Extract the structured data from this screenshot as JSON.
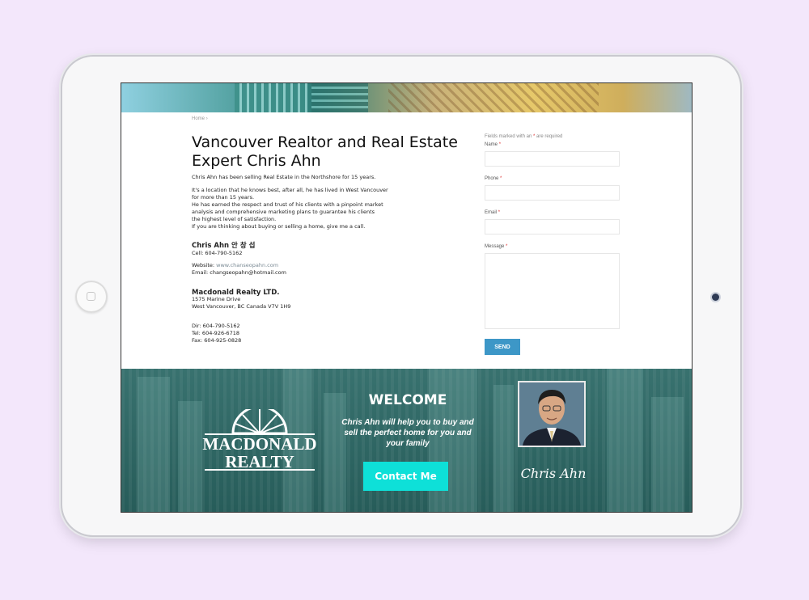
{
  "breadcrumb": {
    "home": "Home",
    "sep": "›"
  },
  "page": {
    "title": "Vancouver Realtor and Real Estate Expert Chris Ahn",
    "intro": "Chris Ahn has been selling Real Estate in the Northshore for 15 years.",
    "body_lines": [
      "It's a location that he knows best, after all, he has lived in West Vancouver",
      "for more than 15 years.",
      "He has earned the respect and trust of his clients with a pinpoint market",
      "analysis and comprehensive marketing plans to guarantee his clients",
      "the highest level of satisfaction.",
      "If you are thinking about buying or selling a home, give me a call."
    ]
  },
  "agent": {
    "name": "Chris Ahn 안 창 섭",
    "cell": "Cell: 604-790-5162",
    "website_label": "Website: ",
    "website": "www.chanseopahn.com",
    "email": "Email: changseopahn@hotmail.com"
  },
  "office": {
    "name": "Macdonald Realty LTD.",
    "address1": "1575 Marine Drive",
    "address2": "West Vancouver, BC Canada V7V 1H9",
    "dir": "Dir: 604-790-5162",
    "tel": "Tel: 604-926-6718",
    "fax": "Fax: 604-925-0828"
  },
  "form": {
    "note_prefix": "Fields marked with an ",
    "note_star": "*",
    "note_suffix": " are required",
    "name_label": "Name",
    "phone_label": "Phone",
    "email_label": "Email",
    "message_label": "Message",
    "star": "*",
    "send": "SEND"
  },
  "footer": {
    "logo_line1": "MACDONALD",
    "logo_line2": "REALTY",
    "welcome": "WELCOME",
    "tagline": "Chris Ahn will help you to buy and sell the perfect home for you and your family",
    "contact_button": "Contact Me",
    "signature": "Chris Ahn"
  },
  "colors": {
    "background": "#f3e7fb",
    "footer_teal": "#2c6966",
    "send_button": "#3d97c7",
    "contact_button": "#0ee0d8",
    "required": "#dd3333"
  }
}
